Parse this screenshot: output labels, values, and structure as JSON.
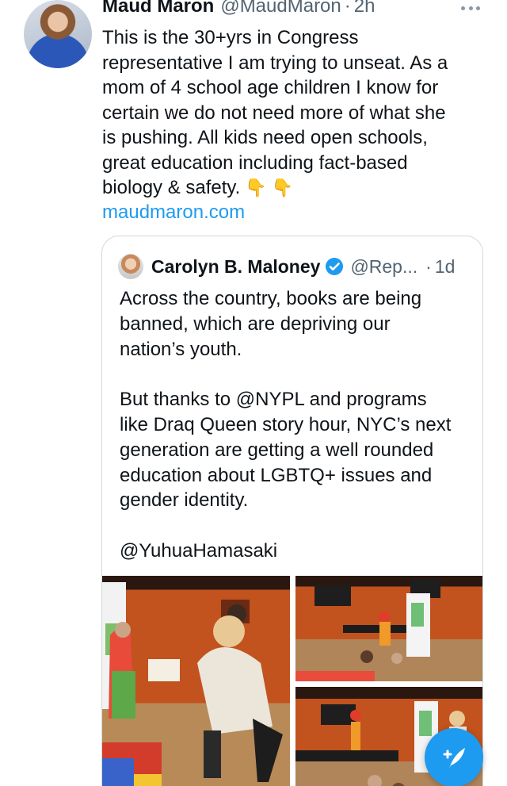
{
  "tweet": {
    "author_name": "Maud Maron",
    "author_handle": "@MaudMaron",
    "separator": "·",
    "timestamp": "2h",
    "text": "This is the 30+yrs in Congress\nrepresentative I am trying to unseat. As a\nmom of 4 school age children I know for\ncertain we do not need more of what she\nis pushing. All kids need open schools,\ngreat education including fact-based\nbiology & safety.",
    "emoji": "👇 👇",
    "link": "maudmaron.com",
    "icons": {
      "avatar": "profile-photo",
      "more": "more-horizontal-icon"
    }
  },
  "quoted_tweet": {
    "author_name": "Carolyn B. Maloney",
    "author_handle": "@Rep...",
    "separator": "·",
    "timestamp": "1d",
    "text": "Across the country, books are being\nbanned, which are depriving our\nnation’s youth.\n\nBut thanks to @NYPL and programs\nlike Draq Queen story hour, NYC’s next\ngeneration are getting a well rounded\neducation about LGBTQ+ issues and\ngender identity.\n\n@YuhuaHamasaki",
    "icons": {
      "verified": "verified-badge-icon"
    }
  },
  "compose": {
    "icon": "compose-tweet-icon"
  },
  "colors": {
    "accent": "#1d9bf0",
    "text": "#0f1419",
    "secondary_text": "#536471",
    "border": "#cfd9de"
  }
}
